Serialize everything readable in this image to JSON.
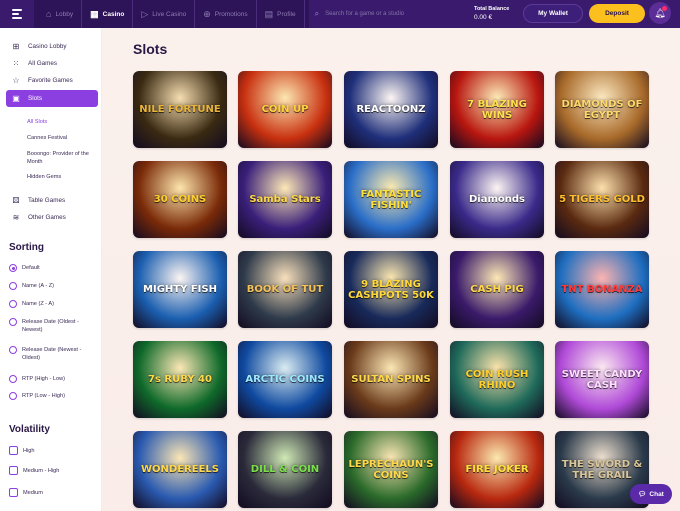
{
  "topbar": {
    "nav": [
      {
        "label": "Lobby",
        "icon": "home-icon"
      },
      {
        "label": "Casino",
        "icon": "grid-icon"
      },
      {
        "label": "Live Casino",
        "icon": "live-play-icon"
      },
      {
        "label": "Promotions",
        "icon": "gamepad-icon"
      },
      {
        "label": "Profile",
        "icon": "profile-card-icon"
      }
    ],
    "active_nav": "Casino",
    "search_placeholder": "Search for a game or a studio",
    "balance_label": "Total Balance",
    "balance_value": "0.00 €",
    "wallet_label": "My Wallet",
    "deposit_label": "Deposit"
  },
  "sidebar": {
    "categories": [
      {
        "label": "Casino Lobby",
        "icon": "grid-icon"
      },
      {
        "label": "All Games",
        "icon": "dots-grid-icon"
      },
      {
        "label": "Favorite Games",
        "icon": "star-icon"
      },
      {
        "label": "Slots",
        "icon": "slots-icon"
      }
    ],
    "subcategories": [
      {
        "label": "All Slots"
      },
      {
        "label": "Cannes Festival"
      },
      {
        "label": "Booongo: Provider of the Month"
      },
      {
        "label": "Hidden Gems"
      }
    ],
    "more_categories": [
      {
        "label": "Table Games",
        "icon": "dice-icon"
      },
      {
        "label": "Other Games",
        "icon": "layers-icon"
      }
    ],
    "sorting_title": "Sorting",
    "sorting": [
      {
        "label": "Default",
        "selected": true
      },
      {
        "label": "Name (A - Z)",
        "selected": false
      },
      {
        "label": "Name (Z - A)",
        "selected": false
      },
      {
        "label": "Release Date (Oldest - Newest)",
        "selected": false
      },
      {
        "label": "Release Date (Newest - Oldest)",
        "selected": false
      },
      {
        "label": "RTP (High - Low)",
        "selected": false
      },
      {
        "label": "RTP (Low - High)",
        "selected": false
      }
    ],
    "volatility_title": "Volatility",
    "volatility": [
      {
        "label": "High"
      },
      {
        "label": "Medium - High"
      },
      {
        "label": "Medium"
      }
    ]
  },
  "main": {
    "title": "Slots",
    "games": [
      {
        "name": "NILE FORTUNE",
        "bg": "#3a2a12",
        "accent": "#e9b43a"
      },
      {
        "name": "COIN UP",
        "bg": "#c8300f",
        "accent": "#ffd23c"
      },
      {
        "name": "REACTOONZ",
        "bg": "#1f2f7a",
        "accent": "#ffffff"
      },
      {
        "name": "7 BLAZING WINS",
        "bg": "#b8160f",
        "accent": "#ffe14d"
      },
      {
        "name": "DIAMONDS OF EGYPT",
        "bg": "#a86a2a",
        "accent": "#ffd86b"
      },
      {
        "name": "30 COINS",
        "bg": "#7a2a08",
        "accent": "#ffcf2e"
      },
      {
        "name": "Samba Stars",
        "bg": "#3a1f7a",
        "accent": "#ffd84a"
      },
      {
        "name": "FANTASTIC FISHIN'",
        "bg": "#2a6ec8",
        "accent": "#ffe03a"
      },
      {
        "name": "Diamonds",
        "bg": "#3a2a8a",
        "accent": "#ffffff"
      },
      {
        "name": "5 TIGERS GOLD",
        "bg": "#5a2a10",
        "accent": "#ffbf2e"
      },
      {
        "name": "MIGHTY FISH",
        "bg": "#1b5fb0",
        "accent": "#ffffff"
      },
      {
        "name": "BOOK OF TUT",
        "bg": "#2e3a4a",
        "accent": "#f3c15c"
      },
      {
        "name": "9 BLAZING CASHPOTS 50K",
        "bg": "#182a5a",
        "accent": "#ffd93a"
      },
      {
        "name": "CASH PIG",
        "bg": "#3a1a6a",
        "accent": "#ffd84a"
      },
      {
        "name": "TNT BONANZA",
        "bg": "#1e6ec0",
        "accent": "#ff3b3b"
      },
      {
        "name": "7s RUBY 40",
        "bg": "#0f6a2a",
        "accent": "#ffd84a"
      },
      {
        "name": "ARCTIC COINS",
        "bg": "#0f4aa0",
        "accent": "#9be8ff"
      },
      {
        "name": "SULTAN SPINS",
        "bg": "#6a3a1a",
        "accent": "#ffd84a"
      },
      {
        "name": "COIN RUSH RHINO",
        "bg": "#1f6a5a",
        "accent": "#ffcf2e"
      },
      {
        "name": "SWEET CANDY CASH",
        "bg": "#b04ad8",
        "accent": "#ffe0ff"
      },
      {
        "name": "WONDEREELS",
        "bg": "#2a5ab0",
        "accent": "#ffd84a"
      },
      {
        "name": "DILL & COIN",
        "bg": "#2a2a3a",
        "accent": "#7ae04a"
      },
      {
        "name": "LEPRECHAUN'S COINS",
        "bg": "#2a6a2a",
        "accent": "#ffd84a"
      },
      {
        "name": "FIRE JOKER",
        "bg": "#b8280f",
        "accent": "#ffe03a"
      },
      {
        "name": "THE SWORD & THE GRAIL",
        "bg": "#2a3a4a",
        "accent": "#d8c59a"
      }
    ]
  },
  "chat": {
    "label": "Chat",
    "icon": "chat-bubble-icon"
  }
}
